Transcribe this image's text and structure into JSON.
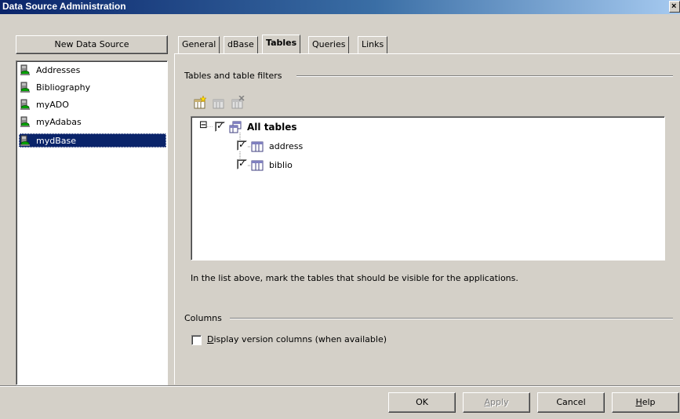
{
  "window": {
    "title": "Data Source Administration",
    "close_glyph": "×"
  },
  "left_panel": {
    "new_button_label": "New Data Source",
    "items": [
      {
        "label": "Addresses",
        "icon": "database-icon"
      },
      {
        "label": "Bibliography",
        "icon": "database-icon"
      },
      {
        "label": "myADO",
        "icon": "database-icon"
      },
      {
        "label": "myAdabas",
        "icon": "database-icon"
      },
      {
        "label": "mydBase",
        "icon": "database-icon",
        "selected": true
      }
    ]
  },
  "tabs": [
    {
      "label": "General"
    },
    {
      "label": "dBase"
    },
    {
      "label": "Tables",
      "active": true
    },
    {
      "label": "Queries"
    },
    {
      "label": "Links"
    }
  ],
  "tables_section": {
    "title": "Tables and table filters",
    "toolbar": [
      "new-table-icon",
      "edit-table-icon",
      "delete-table-icon"
    ],
    "tree": {
      "root": {
        "label": "All tables",
        "checked": true,
        "expander": "⊟"
      },
      "children": [
        {
          "label": "address",
          "checked": true
        },
        {
          "label": "biblio",
          "checked": true
        }
      ]
    },
    "hint": "In the list above, mark the tables that should be visible for the applications."
  },
  "columns_section": {
    "title": "Columns",
    "checkbox_label": "Display version columns (when available)",
    "checkbox_accel": "D",
    "checkbox_rest": "isplay version columns (when available)",
    "checked": false
  },
  "buttons": {
    "ok": "OK",
    "apply_accel": "A",
    "apply_rest": "pply",
    "cancel": "Cancel",
    "help_accel": "H",
    "help_rest": "elp"
  },
  "colors": {
    "selection": "#0a246a",
    "title_start": "#0a246a",
    "face": "#d4d0c8"
  }
}
